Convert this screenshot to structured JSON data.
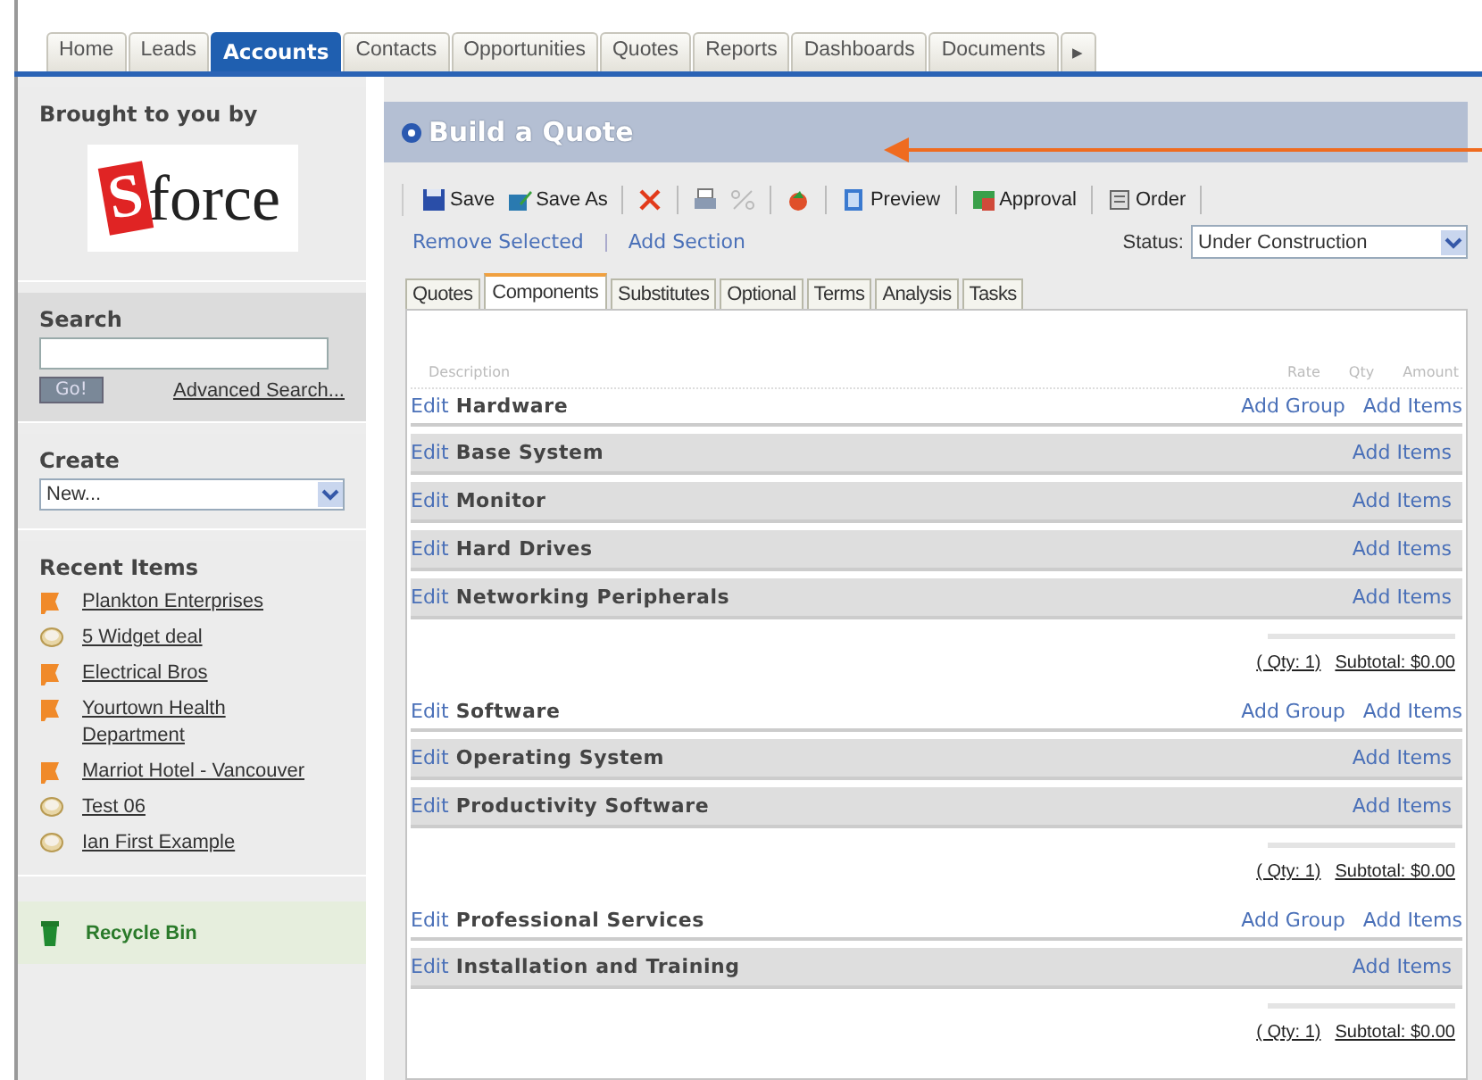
{
  "nav_tabs": [
    {
      "label": "Home",
      "selected": false
    },
    {
      "label": "Leads",
      "selected": false
    },
    {
      "label": "Accounts",
      "selected": true
    },
    {
      "label": "Contacts",
      "selected": false
    },
    {
      "label": "Opportunities",
      "selected": false
    },
    {
      "label": "Quotes",
      "selected": false
    },
    {
      "label": "Reports",
      "selected": false
    },
    {
      "label": "Dashboards",
      "selected": false
    },
    {
      "label": "Documents",
      "selected": false
    },
    {
      "label": "▸",
      "selected": false
    }
  ],
  "sidebar": {
    "brought_by": "Brought to you by",
    "logo": {
      "letter": "S",
      "text": "force"
    },
    "search": {
      "title": "Search",
      "button": "Go!",
      "advanced_link": "Advanced Search..."
    },
    "create": {
      "title": "Create",
      "value": "New..."
    },
    "recent": {
      "title": "Recent Items",
      "items": [
        {
          "label": "Plankton Enterprises",
          "kind": "account"
        },
        {
          "label": "5 Widget deal",
          "kind": "opportunity"
        },
        {
          "label": "Electrical Bros",
          "kind": "account"
        },
        {
          "label": "Yourtown Health Department",
          "kind": "account"
        },
        {
          "label": "Marriot Hotel - Vancouver",
          "kind": "account"
        },
        {
          "label": "Test 06",
          "kind": "opportunity"
        },
        {
          "label": "Ian First Example",
          "kind": "opportunity"
        }
      ]
    },
    "recycle_bin": "Recycle Bin"
  },
  "page": {
    "title": "Build a Quote",
    "toolbar": [
      {
        "kind": "save",
        "label": "Save",
        "disabled": false
      },
      {
        "kind": "save_as",
        "label": "Save As",
        "disabled": false
      },
      {
        "kind": "delete",
        "disabled": false
      },
      {
        "kind": "print",
        "disabled": false
      },
      {
        "kind": "percent",
        "disabled": true
      },
      {
        "kind": "refresh",
        "disabled": false
      },
      {
        "kind": "preview",
        "label": "Preview",
        "disabled": false
      },
      {
        "kind": "approval",
        "label": "Approval",
        "disabled": false
      },
      {
        "kind": "order",
        "label": "Order",
        "disabled": false
      }
    ],
    "links": [
      "Remove Selected",
      "Add Section"
    ],
    "status": {
      "label": "Status:",
      "value": "Under Construction"
    },
    "tabs": [
      {
        "label": "Quotes",
        "selected": false
      },
      {
        "label": "Components",
        "selected": true
      },
      {
        "label": "Substitutes",
        "selected": false
      },
      {
        "label": "Optional",
        "selected": false
      },
      {
        "label": "Terms",
        "selected": false
      },
      {
        "label": "Analysis",
        "selected": false
      },
      {
        "label": "Tasks",
        "selected": false
      }
    ],
    "columns": [
      "Description",
      "Rate",
      "Qty",
      "Amount"
    ],
    "sections": [
      {
        "edit": "Edit",
        "name": "Hardware",
        "links": [
          "Add Group",
          "Add Items"
        ],
        "groups": [
          {
            "edit": "Edit",
            "name": "Base System",
            "link": "Add Items"
          },
          {
            "edit": "Edit",
            "name": "Monitor",
            "link": "Add Items"
          },
          {
            "edit": "Edit",
            "name": "Hard Drives",
            "link": "Add Items"
          },
          {
            "edit": "Edit",
            "name": "Networking Peripherals",
            "link": "Add Items"
          }
        ],
        "qty": "( Qty: 1)",
        "subtotal": "Subtotal: $0.00"
      },
      {
        "edit": "Edit",
        "name": "Software",
        "links": [
          "Add Group",
          "Add Items"
        ],
        "groups": [
          {
            "edit": "Edit",
            "name": "Operating System",
            "link": "Add Items"
          },
          {
            "edit": "Edit",
            "name": "Productivity Software",
            "link": "Add Items"
          }
        ],
        "qty": "( Qty: 1)",
        "subtotal": "Subtotal: $0.00"
      },
      {
        "edit": "Edit",
        "name": "Professional Services",
        "links": [
          "Add Group",
          "Add Items"
        ],
        "groups": [
          {
            "edit": "Edit",
            "name": "Installation and Training",
            "link": "Add Items"
          }
        ],
        "qty": "( Qty: 1)",
        "subtotal": "Subtotal: $0.00"
      }
    ]
  }
}
